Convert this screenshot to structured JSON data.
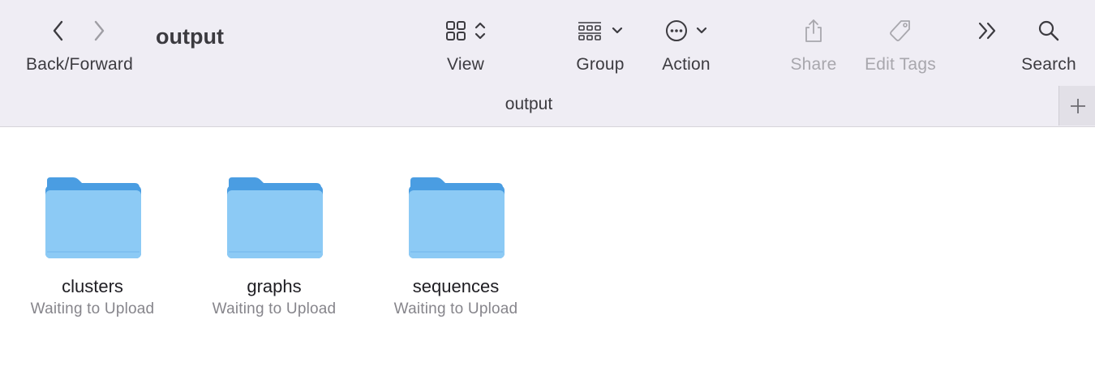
{
  "window": {
    "title": "output"
  },
  "toolbar": {
    "back_forward_label": "Back/Forward",
    "view_label": "View",
    "group_label": "Group",
    "action_label": "Action",
    "share_label": "Share",
    "edit_tags_label": "Edit Tags",
    "search_label": "Search"
  },
  "tabbar": {
    "tab_title": "output"
  },
  "files": [
    {
      "name": "clusters",
      "status": "Waiting to Upload",
      "icon": "folder-icon"
    },
    {
      "name": "graphs",
      "status": "Waiting to Upload",
      "icon": "folder-icon"
    },
    {
      "name": "sequences",
      "status": "Waiting to Upload",
      "icon": "folder-icon"
    }
  ],
  "colors": {
    "toolbar_bg": "#efedf4",
    "folder_front": "#8ccaf5",
    "folder_back": "#4a9de2",
    "disabled_text": "#a8a7ad"
  }
}
